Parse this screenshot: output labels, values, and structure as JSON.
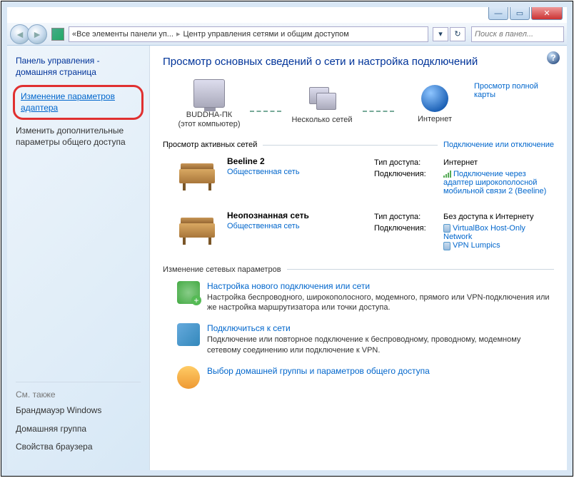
{
  "breadcrumb": {
    "sep": "«",
    "item1": "Все элементы панели уп...",
    "item2": "Центр управления сетями и общим доступом"
  },
  "search": {
    "placeholder": "Поиск в панел..."
  },
  "sidebar": {
    "home_title": "Панель управления - домашняя страница",
    "adapter_settings": "Изменение параметров адаптера",
    "sharing_settings": "Изменить дополнительные параметры общего доступа",
    "see_also": "См. также",
    "firewall": "Брандмауэр Windows",
    "homegroup": "Домашняя группа",
    "browser_props": "Свойства браузера"
  },
  "main": {
    "title": "Просмотр основных сведений о сети и настройка подключений",
    "full_map": "Просмотр полной карты",
    "map": {
      "pc_name": "BUDDHA-ПК",
      "pc_sub": "(этот компьютер)",
      "multi": "Несколько сетей",
      "internet": "Интернет"
    },
    "active_header": "Просмотр активных сетей",
    "conn_toggle": "Подключение или отключение",
    "labels": {
      "access": "Тип доступа:",
      "connections": "Подключения:"
    },
    "net1": {
      "name": "Beeline 2",
      "type": "Общественная сеть",
      "access": "Интернет",
      "conn": "Подключение через адаптер широкополосной мобильной связи 2 (Beeline)"
    },
    "net2": {
      "name": "Неопознанная сеть",
      "type": "Общественная сеть",
      "access": "Без доступа к Интернету",
      "conn1": "VirtualBox Host-Only Network",
      "conn2": "VPN Lumpics"
    },
    "change_header": "Изменение сетевых параметров",
    "task1": {
      "title": "Настройка нового подключения или сети",
      "desc": "Настройка беспроводного, широкополосного, модемного, прямого или VPN-подключения или же настройка маршрутизатора или точки доступа."
    },
    "task2": {
      "title": "Подключиться к сети",
      "desc": "Подключение или повторное подключение к беспроводному, проводному, модемному сетевому соединению или подключение к VPN."
    },
    "task3": {
      "title": "Выбор домашней группы и параметров общего доступа"
    }
  }
}
